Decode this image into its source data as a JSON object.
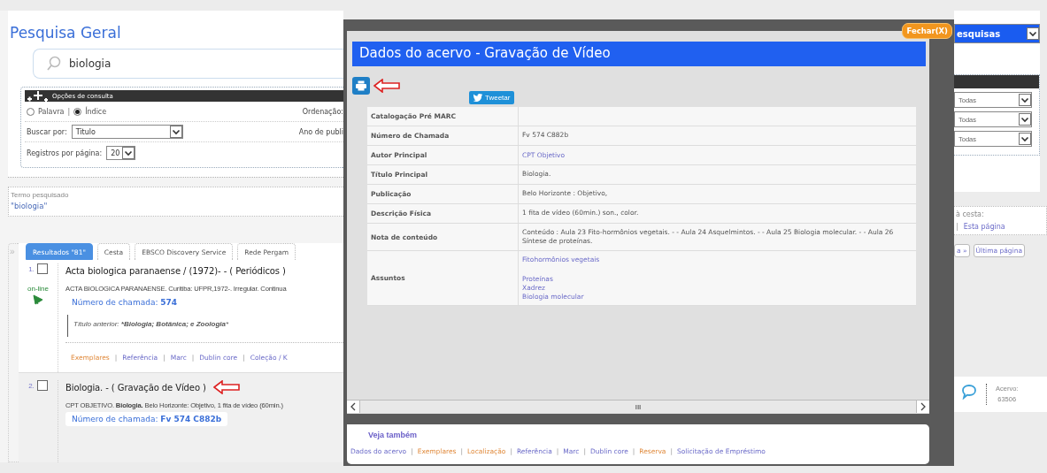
{
  "search_panel": {
    "title": "Pesquisa Geral",
    "query": "biologia",
    "options_title": "Opções de consulta",
    "search_modes": [
      {
        "label": "Palavra",
        "selected": false
      },
      {
        "label": "Índice",
        "selected": true
      }
    ],
    "mode_separator": "|",
    "sort_label": "Ordenação:",
    "search_by_label": "Buscar por:",
    "search_by_value": "Titulo",
    "year_label": "Ano de publi",
    "per_page_label": "Registros por página:",
    "per_page_value": "20"
  },
  "right_panel": {
    "header": "esquisas",
    "filters": [
      "Todas",
      "Todas",
      "Todas"
    ],
    "basket_legend": "à cesta:",
    "basket_separator": "|",
    "basket_link": "Esta página",
    "pager": [
      "a »",
      "Última página"
    ],
    "record_label": "Acervo:",
    "record_number": "63506"
  },
  "search_term": {
    "legend": "Termo pesquisado",
    "value": "\"biologia\""
  },
  "collapse_marker": "»",
  "tabs": [
    {
      "label": "Resultados \"81\"",
      "selected": true
    },
    {
      "label": "Cesta",
      "selected": false
    },
    {
      "label": "EBSCO Discovery Service",
      "selected": false
    },
    {
      "label": "Rede Pergam",
      "selected": false
    }
  ],
  "results": [
    {
      "number": "1.",
      "checked": false,
      "title": "Acta biologica paranaense / (1972)- - ( Periódicos )",
      "arrow": false,
      "online_badge": "on-line",
      "description": "ACTA BIOLOGICA PARANAENSE. Curitiba: UFPR,1972-. Irregular. Continua",
      "call_number_label": "Número de chamada:",
      "call_number": "574",
      "note": "Título anterior: ***Biologia; Botânica; e Zoologia***",
      "links": [
        {
          "text": "Exemplares",
          "kind": "action"
        },
        {
          "text": "|",
          "kind": "separator"
        },
        {
          "text": "Referência",
          "kind": "link"
        },
        {
          "text": "|",
          "kind": "separator"
        },
        {
          "text": "Marc",
          "kind": "link"
        },
        {
          "text": "|",
          "kind": "separator"
        },
        {
          "text": "Dublin core",
          "kind": "link"
        },
        {
          "text": "|",
          "kind": "separator"
        },
        {
          "text": "Coleção / K",
          "kind": "link"
        }
      ]
    },
    {
      "number": "2.",
      "checked": false,
      "title": "Biologia. - ( Gravação de Vídeo )",
      "arrow": true,
      "description": "CPT OBJETIVO. **Biologia.** Belo Horizonte: Objetivo, 1 fita de vídeo (60min.)",
      "call_number_label": "Número de chamada:",
      "call_number": "Fv 574 C882b"
    }
  ],
  "modal": {
    "close": "Fechar(X)",
    "title": "Dados do acervo - Gravação de Vídeo",
    "print_arrow": true,
    "tweet": "Tweetar",
    "rows": [
      {
        "label": "Catalogação Pré MARC",
        "values": []
      },
      {
        "label": "Número de Chamada",
        "values": [
          {
            "text": "Fv 574 C882b",
            "link": false
          }
        ]
      },
      {
        "label": "Autor Principal",
        "values": [
          {
            "text": "CPT Objetivo",
            "link": true
          }
        ]
      },
      {
        "label": "Título Principal",
        "values": [
          {
            "text": "Biologia.",
            "link": false
          }
        ]
      },
      {
        "label": "Publicação",
        "values": [
          {
            "text": "Belo Horizonte : Objetivo,",
            "link": false
          }
        ]
      },
      {
        "label": "Descrição Física",
        "values": [
          {
            "text": "1 fita de vídeo (60min.) son., color.",
            "link": false
          }
        ]
      },
      {
        "label": "Nota de conteúdo",
        "values": [
          {
            "text": "Conteúdo : Aula 23 Fito-hormônios vegetais. - - Aula 24 Asquelmintos. - - Aula 25 Biologia molecular. - - Aula 26 Síntese de proteínas.",
            "link": false
          }
        ]
      },
      {
        "label": "Assuntos",
        "values": [
          {
            "text": "Fitohormônios vegetais",
            "link": true
          },
          {
            "text": "Proteínas",
            "link": true,
            "gap_before": true
          },
          {
            "text": "Xadrez",
            "link": true
          },
          {
            "text": "Biologia molecular",
            "link": true
          }
        ]
      }
    ],
    "scroll_grip": "III",
    "see_also_tab": "Veja também",
    "see_also_links": [
      {
        "text": "Dados do acervo",
        "kind": "link"
      },
      {
        "text": "|",
        "kind": "separator"
      },
      {
        "text": "Exemplares",
        "kind": "action"
      },
      {
        "text": "|",
        "kind": "separator"
      },
      {
        "text": "Localização",
        "kind": "action"
      },
      {
        "text": "|",
        "kind": "separator"
      },
      {
        "text": "Referência",
        "kind": "link"
      },
      {
        "text": "|",
        "kind": "separator"
      },
      {
        "text": "Marc",
        "kind": "link"
      },
      {
        "text": "|",
        "kind": "separator"
      },
      {
        "text": "Dublin core",
        "kind": "link"
      },
      {
        "text": "|",
        "kind": "separator"
      },
      {
        "text": "Reserva",
        "kind": "action"
      },
      {
        "text": "|",
        "kind": "separator"
      },
      {
        "text": "Solicitação de Empréstimo",
        "kind": "link"
      }
    ]
  }
}
